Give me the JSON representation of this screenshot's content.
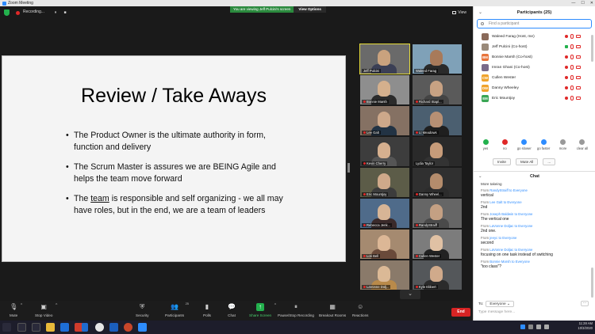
{
  "window": {
    "title": "Zoom Meeting",
    "min": "—",
    "max": "☐",
    "close": "✕"
  },
  "top": {
    "recording": "Recording...",
    "pause": "⏸",
    "stop": "■",
    "viewing": "You are viewing Jeff Pulcini's screen",
    "view_options": "View Options",
    "view": "View"
  },
  "slide": {
    "title": "Review / Take Aways",
    "b1": "The Product Owner is the ultimate authority in form, function and delivery",
    "b2": "The Scrum Master is assures we are BEING Agile and helps the team move forward",
    "b3_pre": "The ",
    "b3_u": "team",
    "b3_post": " is responsible and self organizing - we all may have roles, but in the end, we are a team of leaders"
  },
  "gallery": [
    {
      "name": "Jeff Pulcini",
      "active": true,
      "muted": false,
      "bg": "#6a6a6a",
      "face": "#c9a27e",
      "body": "#3b3f55"
    },
    {
      "name": "Waleed Farag",
      "active": false,
      "muted": false,
      "bg": "#7fa1b8",
      "face": "#a87a5a",
      "body": "#2a2a2a"
    },
    {
      "name": "Bonnie Marsh",
      "active": false,
      "muted": true,
      "bg": "#8e8e8e",
      "face": "#d4b08d",
      "body": "#2b2b2b"
    },
    {
      "name": "Richard Stapl...",
      "active": false,
      "muted": true,
      "bg": "#5a5a5a",
      "face": "#c8a283",
      "body": "#444"
    },
    {
      "name": "Lee Galt",
      "active": false,
      "muted": true,
      "bg": "#857163",
      "face": "#cda88a",
      "body": "#223344"
    },
    {
      "name": "Lt Meadows",
      "active": false,
      "muted": true,
      "bg": "#4b5f70",
      "face": "#b79074",
      "body": "#1f1f1f"
    },
    {
      "name": "Kevin Cherry",
      "active": false,
      "muted": true,
      "bg": "#3d3d3d",
      "face": "#d6b08f",
      "body": "#555"
    },
    {
      "name": "Lydia Taylor",
      "active": false,
      "muted": false,
      "bg": "#2a2a2a",
      "face": "#c79c7a",
      "body": "#333"
    },
    {
      "name": "Eric Mountjoy",
      "active": false,
      "muted": true,
      "bg": "#5c5c48",
      "face": "#cfa98a",
      "body": "#3c3c3c"
    },
    {
      "name": "Danny Wheel...",
      "active": false,
      "muted": true,
      "bg": "#303030",
      "face": "#b48c6c",
      "body": "#2c2c2c"
    },
    {
      "name": "Rebecca Jenk...",
      "active": false,
      "muted": true,
      "bg": "#4f6b8a",
      "face": "#d7b596",
      "body": "#3a2a2a"
    },
    {
      "name": "RandyStraiff",
      "active": false,
      "muted": true,
      "bg": "#666",
      "face": "#c4a083",
      "body": "#4a4a4a"
    },
    {
      "name": "Lori Bell",
      "active": false,
      "muted": true,
      "bg": "#a58a70",
      "face": "#dcb796",
      "body": "#6a4a3a"
    },
    {
      "name": "Cullen Wester",
      "active": false,
      "muted": true,
      "bg": "#7c7c7c",
      "face": "#e0c1a4",
      "body": "#222"
    },
    {
      "name": "LaVonne Dolj...",
      "active": false,
      "muted": true,
      "bg": "#8a7a6a",
      "face": "#dbb996",
      "body": "#b98a4a"
    },
    {
      "name": "Kyle Ebbert",
      "active": false,
      "muted": true,
      "bg": "#54575a",
      "face": "#d0aa8b",
      "body": "#2b2b2b"
    }
  ],
  "gallery_down": "⌄",
  "toolbar": {
    "mute": "Mute",
    "stop_video": "Stop Video",
    "security": "Security",
    "participants": "Participants",
    "participants_count": "25",
    "polls": "Polls",
    "chat": "Chat",
    "share_screen": "Share Screen",
    "pause_rec": "Pause/Stop Recording",
    "breakout": "Breakout Rooms",
    "reactions": "Reactions",
    "end": "End"
  },
  "participants": {
    "header": "Participants (25)",
    "search_placeholder": "Find a participant",
    "list": [
      {
        "name": "Waleed Farag (Host, me)",
        "av": "",
        "avcolor": "#8a6a5a",
        "video": false
      },
      {
        "name": "Jeff Pulcini (Co-host)",
        "av": "",
        "avcolor": "#9a8a7a",
        "video": true
      },
      {
        "name": "Bonnie Marsh (Co-host)",
        "av": "BM",
        "avcolor": "#e8743b",
        "video": false
      },
      {
        "name": "Imran Ghani (Co-host)",
        "av": "",
        "avcolor": "#7a6a8a",
        "video": false
      },
      {
        "name": "Cullen Wester",
        "av": "CW",
        "avcolor": "#f0a32c",
        "video": false
      },
      {
        "name": "Danny Wheeley",
        "av": "DW",
        "avcolor": "#f0a32c",
        "video": false
      },
      {
        "name": "Eric Mountjoy",
        "av": "EM",
        "avcolor": "#3aa655",
        "video": false
      }
    ],
    "reactions": [
      {
        "label": "yes",
        "color": "#23b14d"
      },
      {
        "label": "no",
        "color": "#e02828"
      },
      {
        "label": "go slower",
        "color": "#2d8cff"
      },
      {
        "label": "go faster",
        "color": "#2d8cff"
      },
      {
        "label": "more",
        "color": "#999"
      },
      {
        "label": "clear all",
        "color": "#999"
      }
    ],
    "invite": "Invite",
    "mute_all": "Mute All",
    "more": "..."
  },
  "chat": {
    "header": "Chat",
    "cut_line": "More takeing",
    "messages": [
      {
        "from": "From ",
        "who": "RandyStraiff to Everyone",
        "text": "vertical"
      },
      {
        "from": "From ",
        "who": "Lee Galt to Everyone",
        "text": "2nd"
      },
      {
        "from": "From ",
        "who": "Joseph Baldwin to Everyone",
        "text": "The vertical one"
      },
      {
        "from": "From ",
        "who": "LaVonne Doljac to Everyone",
        "text": "2nd one."
      },
      {
        "from": "From ",
        "who": "jeeyc to Everyone",
        "text": "second"
      },
      {
        "from": "From ",
        "who": "LaVonne Doljac to Everyone",
        "text": "focusing on one task instead of switching"
      },
      {
        "from": "From ",
        "who": "Bonnie Marsh to Everyone",
        "text": "\"too class\"?"
      }
    ],
    "to_label": "To:",
    "to_value": "Everyone ⌄",
    "to_more": "···",
    "input_placeholder": "Type message here..."
  },
  "taskbar": {
    "time": "11:28 AM",
    "date": "10/3/2020"
  }
}
